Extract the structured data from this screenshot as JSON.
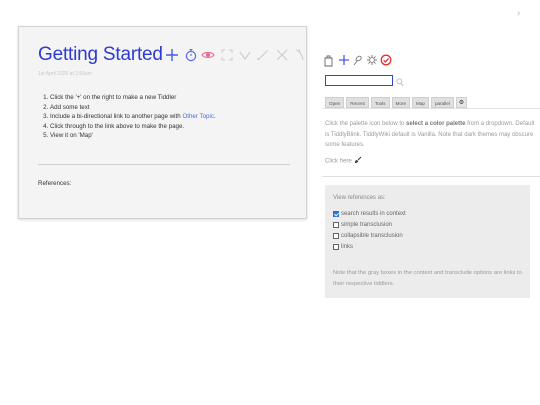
{
  "story": {
    "title": "Getting Started",
    "date": "1st April 2020 at 2:56pm",
    "steps": [
      "Click the '+' on the right to make a new Tiddler",
      "Add some text",
      "Include a bi-directional link to another page with ",
      "Click through to the link above to make the page.",
      "View it on 'Map'"
    ],
    "step3_link": "Other Topic",
    "step3_end": ".",
    "references_label": "References:"
  },
  "toolbar": {
    "icons": [
      "plus-icon",
      "timer-icon",
      "eye-icon",
      "expand-icon",
      "chevron-down-icon",
      "pencil-icon",
      "close-icon",
      "unlink-icon"
    ]
  },
  "sidebar": {
    "icons": [
      "new-tiddler-icon",
      "plus-icon",
      "palette-icon",
      "gear-icon",
      "checkmark-circle-icon"
    ],
    "search": {
      "value": "",
      "placeholder": ""
    },
    "tabs": [
      "Open",
      "Recent",
      "Tools",
      "More",
      "Map",
      "parallel"
    ],
    "note_pre": "Click the palette icon below to ",
    "note_bold": "select a color palette",
    "note_post": " from a dropdown. Default is TiddlyBlink. TiddlyWiki default is Vanilla. Note that dark themes may obscure some features.",
    "click_here": "Click here"
  },
  "references_panel": {
    "heading": "View references as:",
    "options": [
      {
        "label": "search results in context",
        "checked": true
      },
      {
        "label": "simple transclusion",
        "checked": false
      },
      {
        "label": "collapsible transclusion",
        "checked": false
      },
      {
        "label": "links",
        "checked": false
      }
    ],
    "note": "Note that the gray boxes in the context and transclude options are links to their respective tiddlers."
  },
  "colors": {
    "accent": "#2c3bd0",
    "toolbar_plus": "#4a5ae8",
    "toolbar_timer": "#5a68e8",
    "toolbar_eye": "#e8689a",
    "toolbar_gray": "#cccccc",
    "checkmark_red": "#e53030"
  }
}
